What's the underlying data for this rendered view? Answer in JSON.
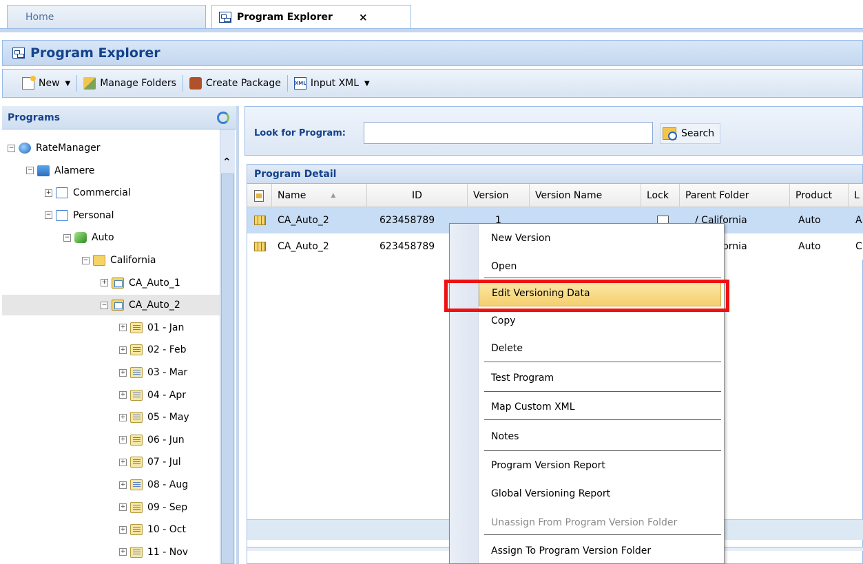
{
  "tabs": {
    "home": "Home",
    "program_explorer": "Program Explorer",
    "close": "×"
  },
  "title": "Program Explorer",
  "toolbar": {
    "new": "New",
    "manage_folders": "Manage Folders",
    "create_package": "Create Package",
    "input_xml": "Input XML"
  },
  "left_panel": {
    "title": "Programs",
    "tree": [
      {
        "label": "RateManager",
        "level": 0,
        "icon": "database-icon",
        "toggle": "⊟"
      },
      {
        "label": "Alamere",
        "level": 1,
        "icon": "company-icon",
        "toggle": "⊟"
      },
      {
        "label": "Commercial",
        "level": 2,
        "icon": "line-of-business-icon",
        "toggle": "⊞"
      },
      {
        "label": "Personal",
        "level": 2,
        "icon": "line-of-business-icon",
        "toggle": "⊟"
      },
      {
        "label": "Auto",
        "level": 3,
        "icon": "product-icon",
        "toggle": "⊟"
      },
      {
        "label": "California",
        "level": 4,
        "icon": "folder-icon",
        "toggle": "⊟"
      },
      {
        "label": "CA_Auto_1",
        "level": 5,
        "icon": "program-icon",
        "toggle": "⊞"
      },
      {
        "label": "CA_Auto_2",
        "level": 5,
        "icon": "program-icon",
        "toggle": "⊟",
        "selected": true
      },
      {
        "label": "01 - Jan",
        "level": 6,
        "icon": "version-folder-icon",
        "toggle": "⊞"
      },
      {
        "label": "02 - Feb",
        "level": 6,
        "icon": "version-folder-icon",
        "toggle": "⊞"
      },
      {
        "label": "03 - Mar",
        "level": 6,
        "icon": "version-folder-icon",
        "toggle": "⊞"
      },
      {
        "label": "04 - Apr",
        "level": 6,
        "icon": "version-folder-icon",
        "toggle": "⊞"
      },
      {
        "label": "05 - May",
        "level": 6,
        "icon": "version-folder-icon",
        "toggle": "⊞"
      },
      {
        "label": "06 - Jun",
        "level": 6,
        "icon": "version-folder-icon",
        "toggle": "⊞"
      },
      {
        "label": "07 - Jul",
        "level": 6,
        "icon": "version-folder-icon",
        "toggle": "⊞"
      },
      {
        "label": "08 - Aug",
        "level": 6,
        "icon": "version-folder-icon",
        "toggle": "⊞"
      },
      {
        "label": "09 - Sep",
        "level": 6,
        "icon": "version-folder-icon",
        "toggle": "⊞"
      },
      {
        "label": "10 - Oct",
        "level": 6,
        "icon": "version-folder-icon",
        "toggle": "⊞"
      },
      {
        "label": "11 - Nov",
        "level": 6,
        "icon": "version-folder-icon",
        "toggle": "⊞"
      }
    ]
  },
  "search": {
    "label": "Look for Program:",
    "value": "",
    "button": "Search"
  },
  "grid": {
    "title": "Program Detail",
    "columns": [
      "Name",
      "ID",
      "Version",
      "Version Name",
      "Lock",
      "Parent Folder",
      "Product",
      "L"
    ],
    "rows": [
      {
        "name": "CA_Auto_2",
        "id": "623458789",
        "version": "1",
        "parent": "/ California",
        "product": "Auto",
        "extra": "A"
      },
      {
        "name": "CA_Auto_2",
        "id": "623458789",
        "version": "",
        "parent": "/ California",
        "product": "Auto",
        "extra": "C"
      }
    ]
  },
  "context_menu": [
    {
      "label": "New Version"
    },
    {
      "label": "Open"
    },
    {
      "label": "Edit Versioning Data",
      "highlighted": true
    },
    {
      "label": "Copy"
    },
    {
      "label": "Delete"
    },
    {
      "label": "Test Program"
    },
    {
      "label": "Map Custom XML"
    },
    {
      "label": "Notes"
    },
    {
      "label": "Program Version Report"
    },
    {
      "label": "Global Versioning Report"
    },
    {
      "label": "Unassign From Program Version Folder",
      "disabled": true
    },
    {
      "label": "Assign To Program Version Folder"
    }
  ],
  "colors": {
    "header_blue": "#15428b",
    "border_blue": "#99bbe8",
    "selection_blue": "#c7dcf5",
    "highlight_red": "#ee1111",
    "menu_highlight": "#f4cf6e"
  }
}
